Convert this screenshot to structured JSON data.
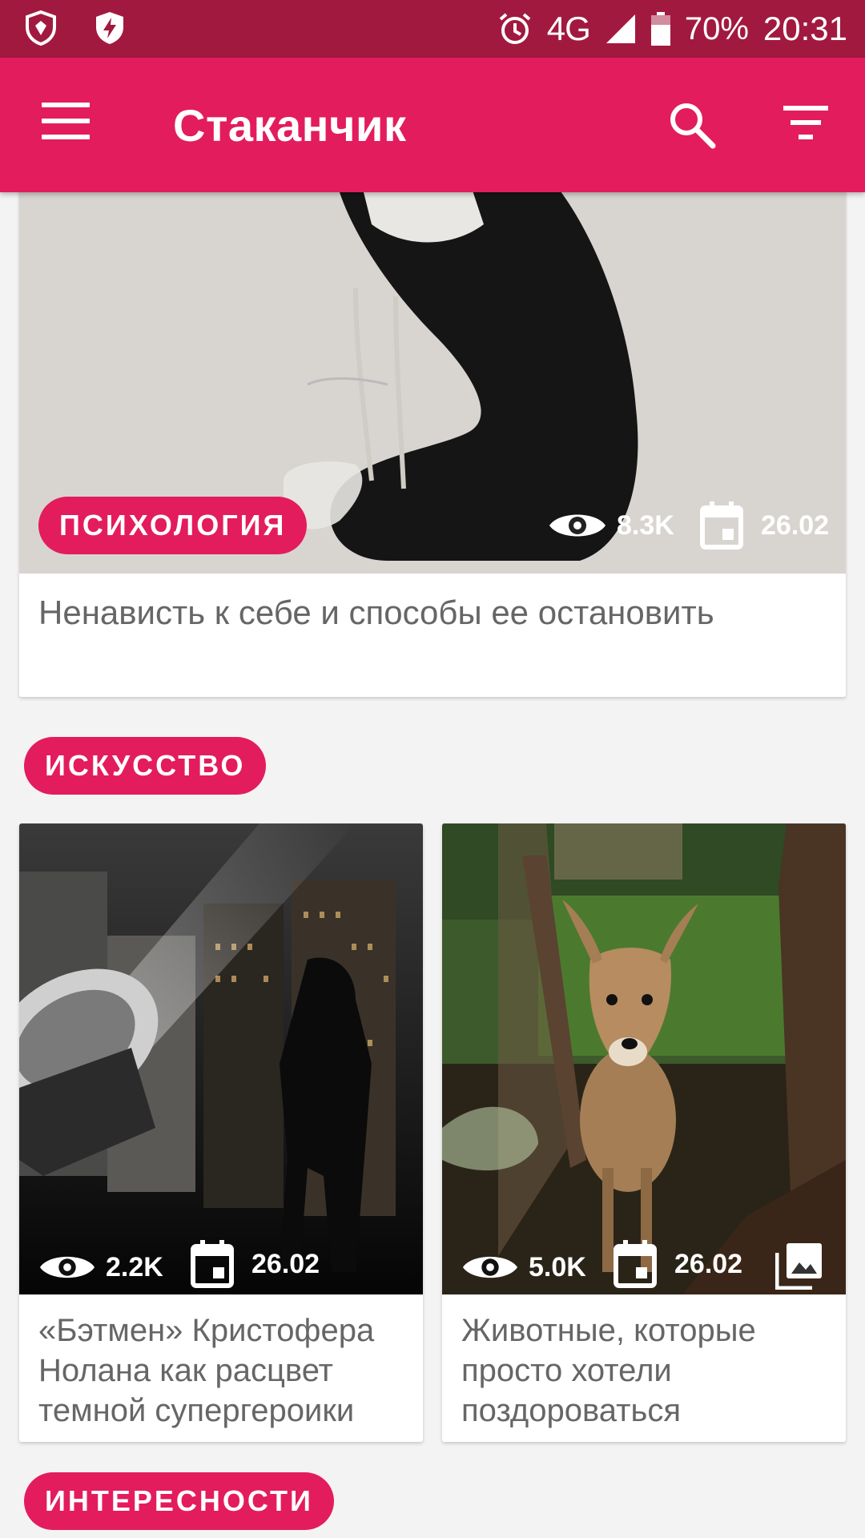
{
  "status_bar": {
    "icons_left": [
      "app-shield-icon",
      "shield-bolt-icon"
    ],
    "alarm_icon": "alarm-icon",
    "network": "4G",
    "network_super": "4G",
    "battery": "70%",
    "time": "20:31"
  },
  "app_bar": {
    "title": "Стаканчик",
    "menu_icon": "menu-icon",
    "search_icon": "search-icon",
    "filter_icon": "filter-icon"
  },
  "featured": {
    "category": "ПСИХОЛОГИЯ",
    "views": "8.3K",
    "date": "26.02",
    "title": "Ненависть к себе и способы ее остановить"
  },
  "sections": [
    {
      "label": "ИСКУССТВО",
      "cards": [
        {
          "views": "2.2K",
          "date": "26.02",
          "title": "«Бэтмен» Кристофера Нолана как расцвет темной супергероики"
        },
        {
          "views": "5.0K",
          "date": "26.02",
          "has_gallery": true,
          "title": "Животные, которые просто хотели поздороваться"
        }
      ]
    },
    {
      "label": "ИНТЕРЕСНОСТИ"
    }
  ],
  "colors": {
    "status_bar": "#a2193f",
    "app_bar": "#e31c5e",
    "accent_pill": "#e31c5e",
    "background": "#f4f3f3"
  }
}
